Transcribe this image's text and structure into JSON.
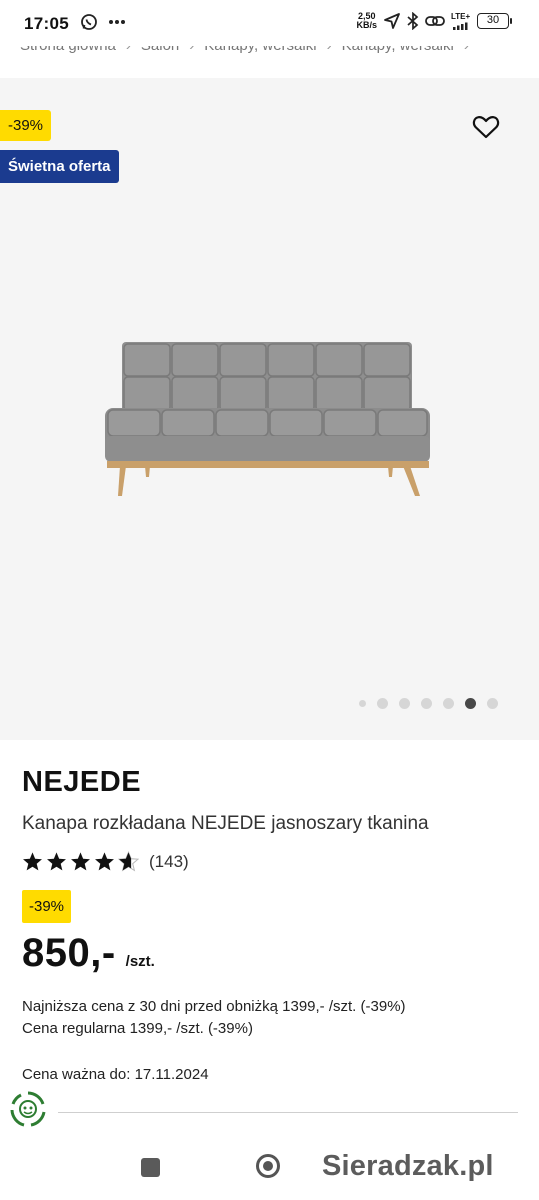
{
  "status_bar": {
    "time": "17:05",
    "net_speed_value": "2,50",
    "net_speed_unit": "KB/s",
    "network": "LTE+",
    "battery": "30"
  },
  "breadcrumb": [
    "Strona główna",
    "Salon",
    "Kanapy, wersalki",
    "Kanapy, wersalki"
  ],
  "gallery": {
    "discount_badge": "-39%",
    "offer_badge": "Świetna oferta",
    "dots_total": 7,
    "active_dot": 5
  },
  "product": {
    "brand": "NEJEDE",
    "description": "Kanapa rozkładana NEJEDE jasnoszary tkanina",
    "rating": 4.6,
    "review_count": "(143)",
    "discount_badge": "-39%",
    "price": "850,-",
    "price_unit": "/szt.",
    "lowest_price_note": "Najniższa cena z 30 dni przed obniżką 1399,- /szt. (-39%)",
    "regular_price_note": "Cena regularna 1399,- /szt. (-39%)",
    "valid_until": "Cena ważna do: 17.11.2024"
  },
  "watermark": "Sieradzak.pl",
  "colors": {
    "discount_yellow": "#ffdb00",
    "offer_blue": "#1b3b8f",
    "gallery_bg": "#f5f5f5"
  }
}
